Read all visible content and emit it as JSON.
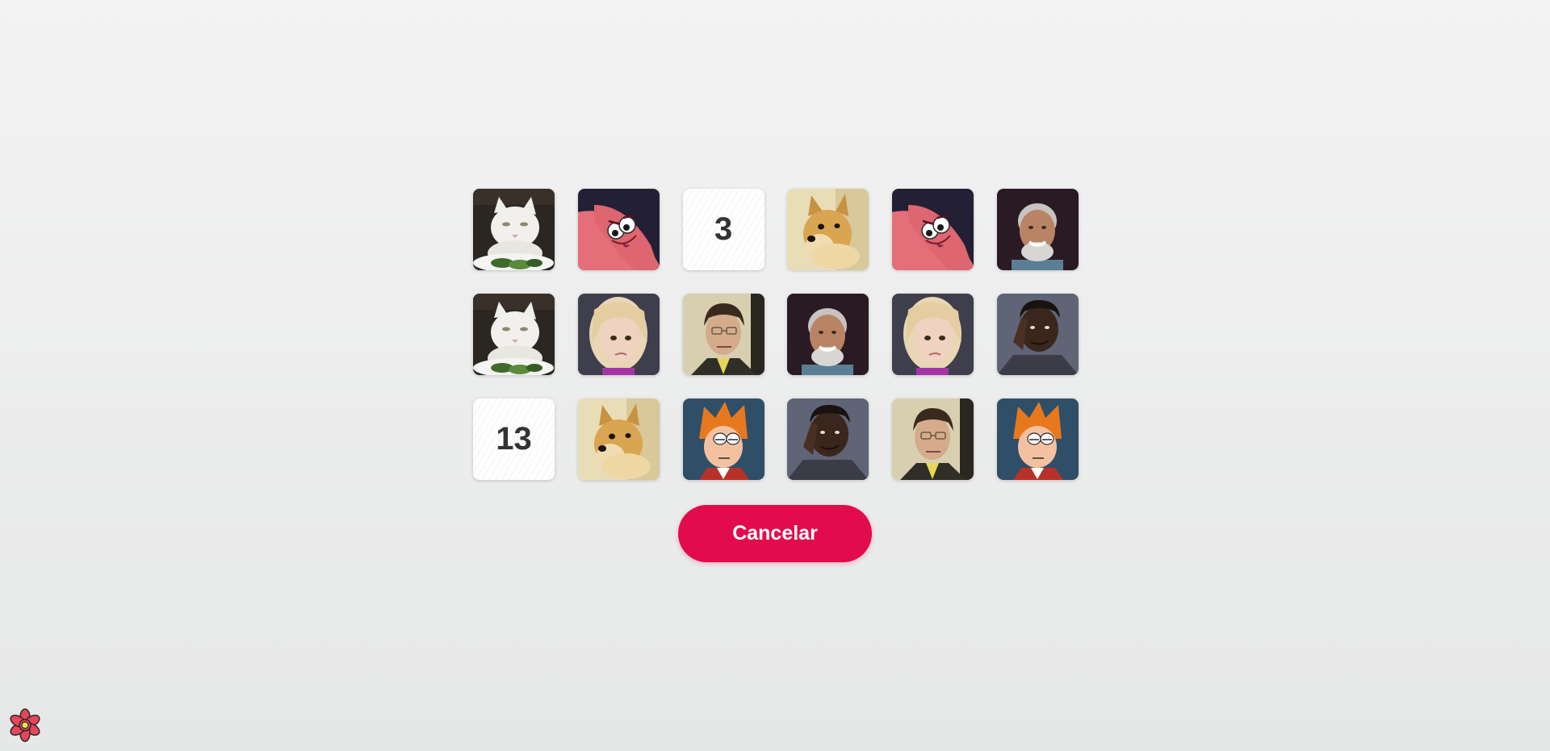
{
  "board": {
    "cards": [
      {
        "state": "face",
        "meme": "woman-yelling-cat"
      },
      {
        "state": "face",
        "meme": "savage-patrick"
      },
      {
        "state": "hidden",
        "number": "3"
      },
      {
        "state": "face",
        "meme": "doge"
      },
      {
        "state": "face",
        "meme": "savage-patrick"
      },
      {
        "state": "face",
        "meme": "hide-the-pain-harold"
      },
      {
        "state": "face",
        "meme": "woman-yelling-cat"
      },
      {
        "state": "face",
        "meme": "side-eyeing-chloe"
      },
      {
        "state": "face",
        "meme": "dwight-schrute"
      },
      {
        "state": "face",
        "meme": "hide-the-pain-harold"
      },
      {
        "state": "face",
        "meme": "side-eyeing-chloe"
      },
      {
        "state": "face",
        "meme": "roll-safe"
      },
      {
        "state": "hidden",
        "number": "13"
      },
      {
        "state": "face",
        "meme": "doge"
      },
      {
        "state": "face",
        "meme": "futurama-fry"
      },
      {
        "state": "face",
        "meme": "roll-safe"
      },
      {
        "state": "face",
        "meme": "dwight-schrute"
      },
      {
        "state": "face",
        "meme": "futurama-fry"
      }
    ]
  },
  "actions": {
    "cancel_label": "Cancelar"
  },
  "colors": {
    "accent": "#e20b4c",
    "background_top": "#f3f3f3",
    "background_bottom": "#e6e7e7"
  },
  "corner_logo": {
    "icon": "flower-logo-icon"
  }
}
